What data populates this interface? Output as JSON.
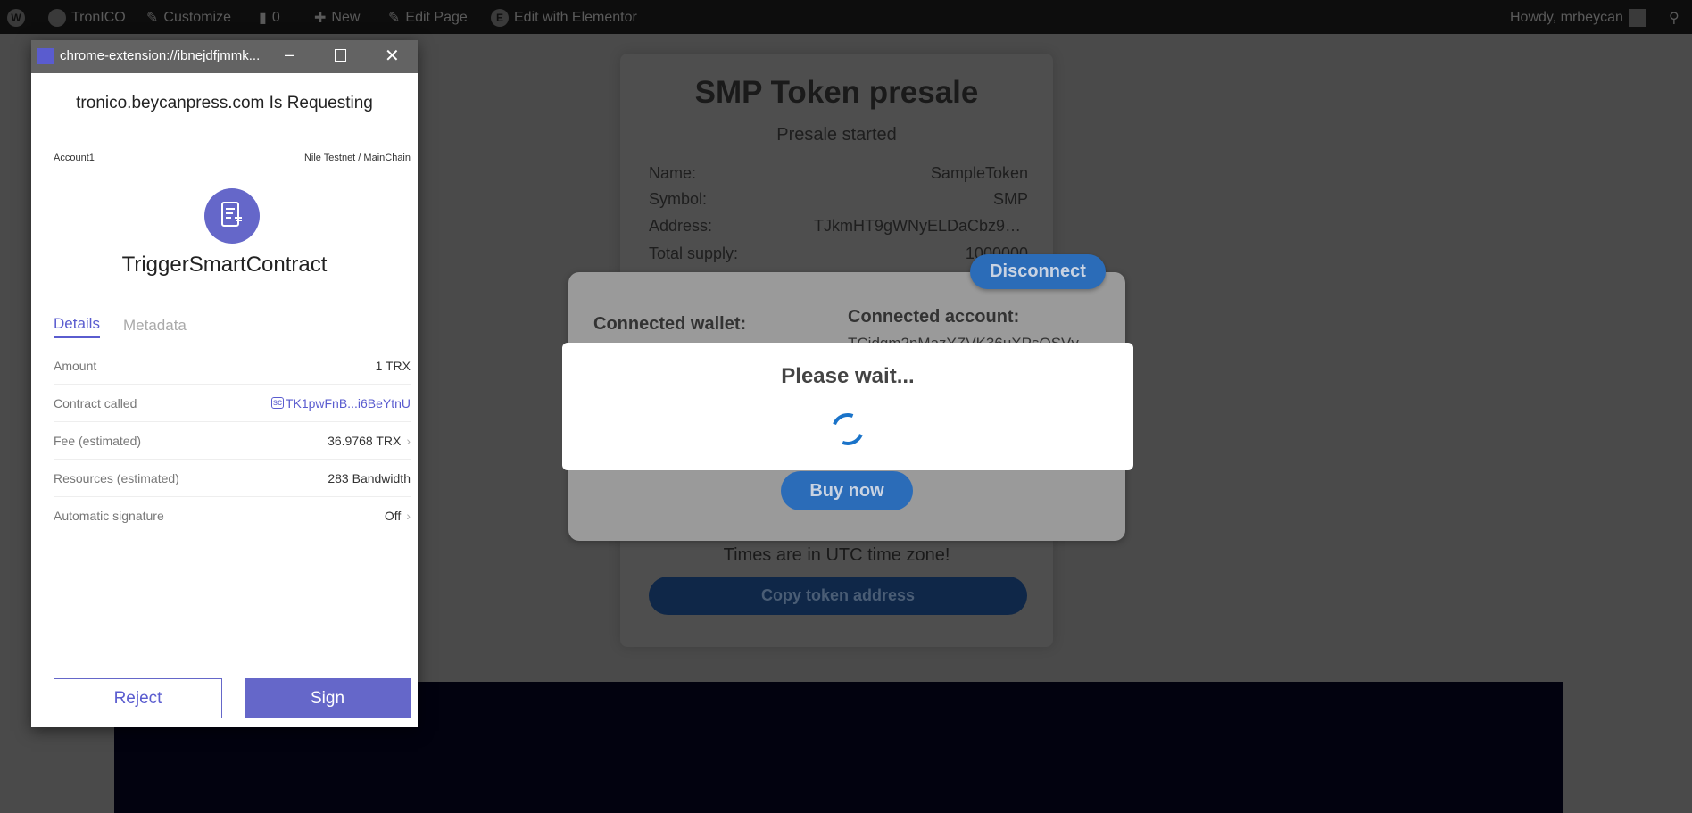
{
  "adminbar": {
    "site": "TronICO",
    "customize": "Customize",
    "comments": "0",
    "new": "New",
    "edit_page": "Edit Page",
    "elementor": "Edit with Elementor",
    "howdy": "Howdy, mrbeycan"
  },
  "card": {
    "title": "SMP Token presale",
    "status": "Presale started",
    "rows": [
      {
        "label": "Name:",
        "value": "SampleToken"
      },
      {
        "label": "Symbol:",
        "value": "SMP"
      },
      {
        "label": "Address:",
        "value": "TJkmHT9gWNyELDaCbz9…"
      },
      {
        "label": "Total supply:",
        "value": "1000000"
      }
    ],
    "timezone_note": "Times are in UTC time zone!",
    "copy_label": "Copy token address"
  },
  "connect": {
    "disconnect_label": "Disconnect",
    "wallet_label": "Connected wallet:",
    "account_label": "Connected account:",
    "account_value": "TCjdqm2nMazYZVK36uXPsQSVv",
    "buy_label": "Buy now"
  },
  "wait": {
    "title": "Please wait..."
  },
  "popup": {
    "window_title": "chrome-extension://ibnejdfjmmk...",
    "requesting": "tronico.beycanpress.com Is Requesting",
    "account": "Account1",
    "network": "Nile Testnet / MainChain",
    "tx_type": "TriggerSmartContract",
    "tabs": [
      {
        "label": "Details",
        "active": true
      },
      {
        "label": "Metadata",
        "active": false
      }
    ],
    "rows": [
      {
        "label": "Amount",
        "value": "1 TRX"
      },
      {
        "label": "Contract called",
        "badge": "sc",
        "value": "TK1pwFnB...i6BeYtnU"
      },
      {
        "label": "Fee (estimated)",
        "value": "36.9768 TRX"
      },
      {
        "label": "Resources (estimated)",
        "value": "283 Bandwidth"
      },
      {
        "label": "Automatic signature",
        "value": "Off"
      }
    ],
    "reject_label": "Reject",
    "sign_label": "Sign",
    "accent": "#6567c9"
  }
}
